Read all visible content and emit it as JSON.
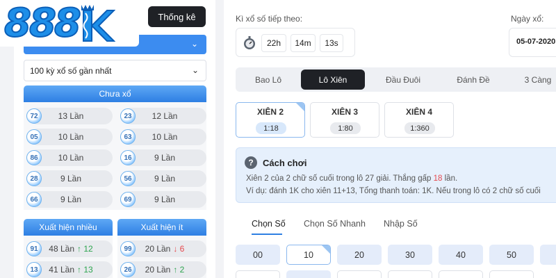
{
  "logo": {
    "text": "888",
    "letter": "K"
  },
  "left": {
    "top_button": "Thống kê",
    "select_recent": "100 kỳ xổ số gần nhất",
    "not_drawn": {
      "title": "Chưa xổ",
      "items": [
        {
          "num": "72",
          "label": "13 Lần"
        },
        {
          "num": "23",
          "label": "12 Lần"
        },
        {
          "num": "05",
          "label": "10 Lần"
        },
        {
          "num": "63",
          "label": "10 Lần"
        },
        {
          "num": "86",
          "label": "10 Lần"
        },
        {
          "num": "16",
          "label": "9 Lần"
        },
        {
          "num": "28",
          "label": "9 Lần"
        },
        {
          "num": "56",
          "label": "9 Lần"
        },
        {
          "num": "66",
          "label": "9 Lần"
        },
        {
          "num": "69",
          "label": "9 Lần"
        }
      ]
    },
    "most": {
      "title": "Xuất hiện nhiều",
      "items": [
        {
          "num": "91",
          "label": "48 Lần",
          "delta": "↑ 12"
        },
        {
          "num": "13",
          "label": "41 Lần",
          "delta": "↑ 13"
        }
      ]
    },
    "least": {
      "title": "Xuất hiện ít",
      "items": [
        {
          "num": "99",
          "label": "20 Lần",
          "delta": "↓ 6"
        },
        {
          "num": "26",
          "label": "20 Lần",
          "delta": "↑ 2"
        }
      ]
    }
  },
  "right": {
    "next_label": "Kì xổ số tiếp theo:",
    "timer": {
      "h": "22h",
      "m": "14m",
      "s": "13s"
    },
    "date_label": "Ngày xổ:",
    "date_value": "05-07-2020",
    "tabs": [
      "Bao Lô",
      "Lô Xiên",
      "Đầu Đuôi",
      "Đánh Đề",
      "3 Càng"
    ],
    "active_tab": 1,
    "xien": [
      {
        "name": "XIÊN 2",
        "rate": "1:18"
      },
      {
        "name": "XIÊN 3",
        "rate": "1:80"
      },
      {
        "name": "XIÊN 4",
        "rate": "1:360"
      }
    ],
    "info": {
      "title": "Cách chơi",
      "line1_a": "Xiên 2 của 2 chữ số cuối trong lô 27 giải. Thắng gấp ",
      "line1_b": "18",
      "line1_c": " lần.",
      "line2": "Ví dụ: đánh 1K cho xiên 11+13, Tổng thanh toán: 1K. Nếu trong lô có 2 chữ số cuối"
    },
    "sub_tabs": [
      "Chọn Số",
      "Chọn Số Nhanh",
      "Nhập Số"
    ],
    "numbers": [
      "00",
      "10",
      "20",
      "30",
      "40",
      "50"
    ]
  },
  "colors": {
    "accent": "#2e7fe3",
    "dark": "#1f2126",
    "up": "#2ea44f",
    "down": "#e5484d"
  }
}
